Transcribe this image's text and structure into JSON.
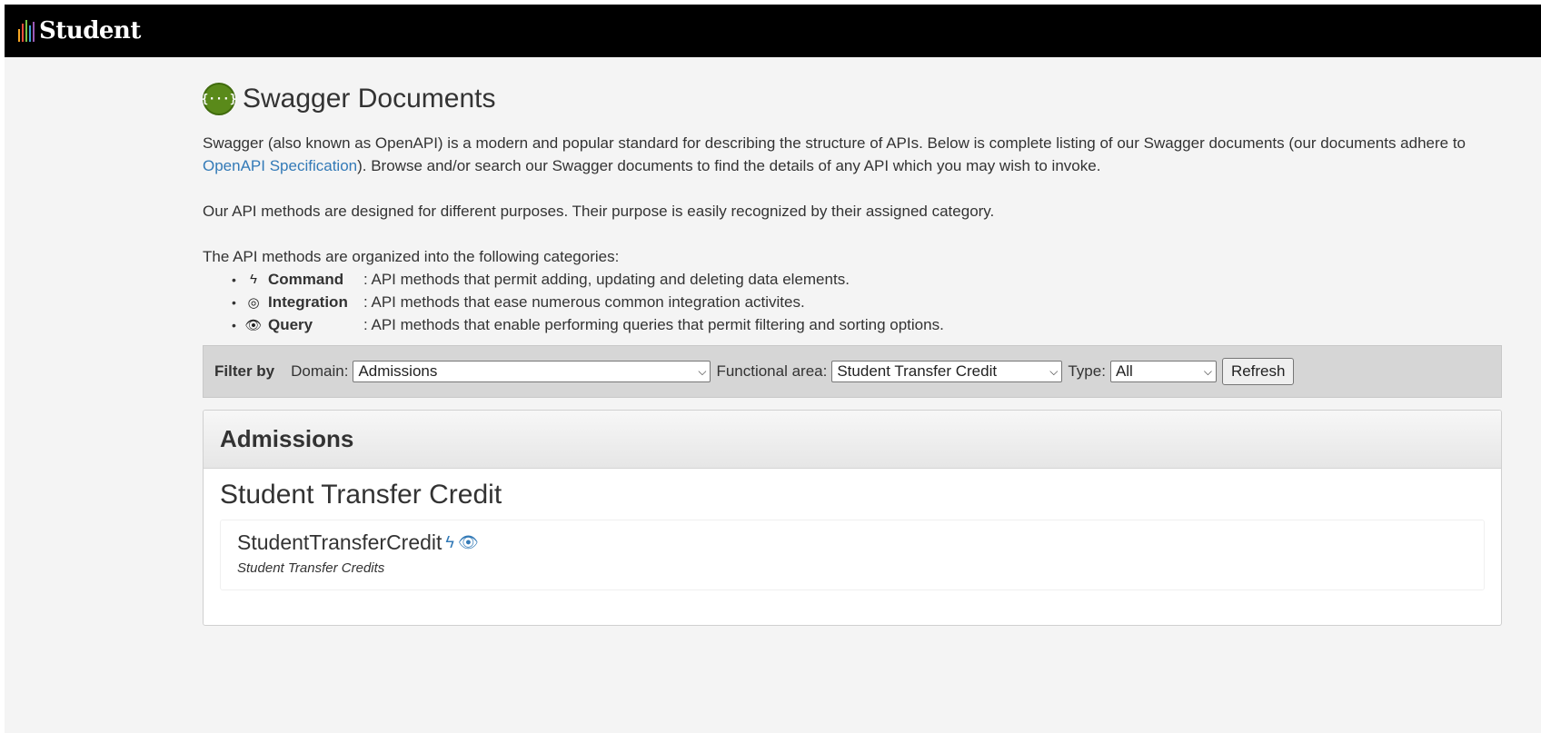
{
  "header": {
    "logo_text": "Student",
    "logo_bar_colors": [
      "#f5a623",
      "#e94e3c",
      "#7ac143",
      "#3aa0d8",
      "#9b59b6"
    ]
  },
  "page": {
    "title": "Swagger Documents",
    "swagger_icon_glyph": "{···}",
    "intro_before_link": "Swagger (also known as OpenAPI) is a modern and popular standard for describing the structure of APIs. Below is complete listing of our Swagger documents (our documents adhere to ",
    "intro_link": "OpenAPI Specification",
    "intro_after_link": "). Browse and/or search our Swagger documents to find the details of any API which you may wish to invoke.",
    "purpose_text": "Our API methods are designed for different purposes. Their purpose is easily recognized by their assigned category.",
    "categories_intro": "The API methods are organized into the following categories:",
    "categories": [
      {
        "icon": "bolt-icon",
        "glyph": "ϟ",
        "name": "Command",
        "desc": ": API methods that permit adding, updating and deleting data elements."
      },
      {
        "icon": "target-icon",
        "glyph": "◎",
        "name": "Integration",
        "desc": ": API methods that ease numerous common integration activites."
      },
      {
        "icon": "eye-icon",
        "glyph": "👁",
        "name": "Query",
        "desc": ": API methods that enable performing queries that permit filtering and sorting options."
      }
    ]
  },
  "filter": {
    "label": "Filter by",
    "domain_label": "Domain:",
    "domain_value": "Admissions",
    "functional_area_label": "Functional area:",
    "functional_area_value": "Student Transfer Credit",
    "type_label": "Type:",
    "type_value": "All",
    "refresh_label": "Refresh"
  },
  "results": {
    "domain_heading": "Admissions",
    "area_heading": "Student Transfer Credit",
    "documents": [
      {
        "name": "StudentTransferCredit",
        "description": "Student Transfer Credits",
        "icons": [
          "bolt-icon",
          "eye-icon"
        ]
      }
    ]
  },
  "colors": {
    "link": "#337ab7",
    "swagger_green": "#5a8a1a",
    "topbar": "#000000"
  }
}
